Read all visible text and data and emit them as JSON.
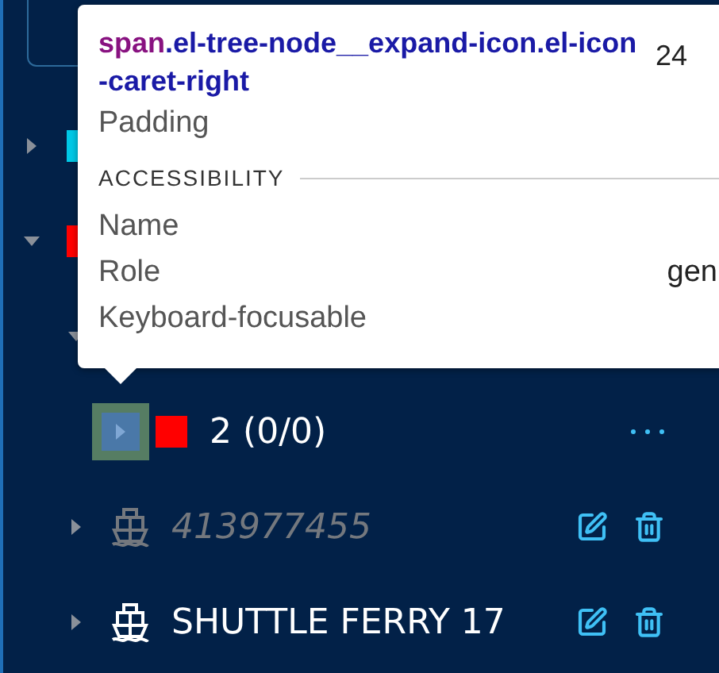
{
  "tree": [
    {
      "kind": "group",
      "color": "#00c8e6",
      "expanded": false,
      "inspected": false
    },
    {
      "kind": "group",
      "color": "#ff0000",
      "expanded": true,
      "inspected": false,
      "children": [
        {
          "kind": "folder",
          "expanded": true,
          "inspected": false,
          "children": [
            {
              "kind": "group",
              "label": "2 (0/0)",
              "color": "#ff0000",
              "expanded": false,
              "inspected": true
            }
          ]
        },
        {
          "kind": "ship",
          "label": "413977455",
          "online": false,
          "expanded": false,
          "inspected": false
        },
        {
          "kind": "ship",
          "label": "SHUTTLE FERRY 17",
          "online": true,
          "expanded": false,
          "inspected": false
        }
      ]
    }
  ],
  "inspector": {
    "tag": "span",
    "selector": ".el-tree-node__expand-icon.el-icon-caret-right",
    "size": "24",
    "rows": [
      {
        "label": "Padding"
      }
    ],
    "section": "ACCESSIBILITY",
    "accessibility": [
      {
        "label": "Name"
      },
      {
        "label": "Role",
        "value": "gen"
      },
      {
        "label": "Keyboard-focusable"
      }
    ]
  }
}
